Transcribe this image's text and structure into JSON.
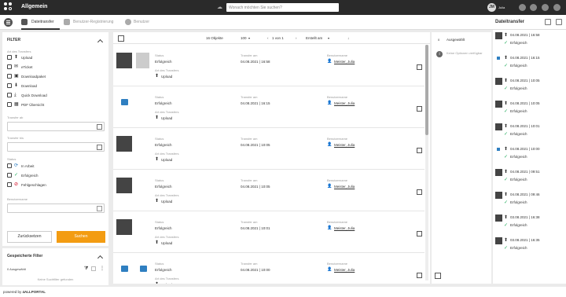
{
  "app": {
    "title": "Allgemein",
    "search_placeholder": "Wonach möchten Sie suchen?",
    "user_initials": "JM",
    "user_name": "Julia"
  },
  "tabs": [
    {
      "label": "Dateitransfer"
    },
    {
      "label": "Benutzer-Registrierung"
    },
    {
      "label": "Benutzer"
    }
  ],
  "right_title": "Dateitransfer",
  "filter": {
    "title": "FILTER",
    "transfer_type_label": "Art des Transfers",
    "types": [
      {
        "label": "Upload",
        "icon": "upload-icon"
      },
      {
        "label": "eTicket",
        "icon": "ticket-icon"
      },
      {
        "label": "Downloadpaket",
        "icon": "package-icon"
      },
      {
        "label": "Download",
        "icon": "download-icon"
      },
      {
        "label": "Quick Download",
        "icon": "quick-download-icon"
      },
      {
        "label": "PDF Übersicht",
        "icon": "pdf-grid-icon"
      }
    ],
    "from_label": "Transfer ab",
    "to_label": "Transfer bis",
    "status_label": "Status",
    "statuses": [
      {
        "label": "In Arbeit",
        "icon": "progress-icon"
      },
      {
        "label": "Erfolgreich",
        "icon": "check-icon"
      },
      {
        "label": "Fehlgeschlagen",
        "icon": "forbidden-icon"
      }
    ],
    "username_label": "Benutzername",
    "reset_label": "Zurücksetzen",
    "search_label": "Suchen"
  },
  "saved": {
    "title": "Gespeicherte Filter",
    "selected": "0 Ausgewählt",
    "empty": "Keine Suchfilter gefunden"
  },
  "toolbar": {
    "objects": "16 Objekte",
    "per_page": "100",
    "pagination": "1 von 1",
    "sort": "Erstellt am"
  },
  "labels": {
    "status": "Status",
    "transfer_date": "Transfer am",
    "username": "Benutzername",
    "transfer_type": "Art des Transfers"
  },
  "rows": [
    {
      "status": "Erfolgreich",
      "date": "04.08.2021 | 16:58",
      "user": "Meister, Julia",
      "type": "Upload",
      "thumb": "photo"
    },
    {
      "status": "Erfolgreich",
      "date": "04.08.2021 | 16:15",
      "user": "Meister, Julia",
      "type": "Upload",
      "thumb": "icon"
    },
    {
      "status": "Erfolgreich",
      "date": "04.08.2021 | 10:05",
      "user": "Meister, Julia",
      "type": "Upload",
      "thumb": "photo"
    },
    {
      "status": "Erfolgreich",
      "date": "04.08.2021 | 10:05",
      "user": "Meister, Julia",
      "type": "Upload",
      "thumb": "photo"
    },
    {
      "status": "Erfolgreich",
      "date": "04.08.2021 | 10:01",
      "user": "Meister, Julia",
      "type": "Upload",
      "thumb": "photo"
    },
    {
      "status": "Erfolgreich",
      "date": "04.08.2021 | 10:00",
      "user": "Meister, Julia",
      "type": "Upload",
      "thumb": "icons"
    }
  ],
  "selection": {
    "count": "0",
    "title": "Ausgewählt",
    "none": "Keine Optionen verfügbar"
  },
  "recent": [
    {
      "time": "04.08.2021 | 16:58",
      "status": "Erfolgreich"
    },
    {
      "time": "04.08.2021 | 16:15",
      "status": "Erfolgreich"
    },
    {
      "time": "04.08.2021 | 10:05",
      "status": "Erfolgreich"
    },
    {
      "time": "04.08.2021 | 10:05",
      "status": "Erfolgreich"
    },
    {
      "time": "04.08.2021 | 10:01",
      "status": "Erfolgreich"
    },
    {
      "time": "04.08.2021 | 10:00",
      "status": "Erfolgreich"
    },
    {
      "time": "04.08.2021 | 09:51",
      "status": "Erfolgreich"
    },
    {
      "time": "04.08.2021 | 09:46",
      "status": "Erfolgreich"
    },
    {
      "time": "03.08.2021 | 16:38",
      "status": "Erfolgreich"
    },
    {
      "time": "03.08.2021 | 16:35",
      "status": "Erfolgreich"
    }
  ],
  "footer": {
    "text": "powered by",
    "brand": "4ALLPORTAL"
  }
}
